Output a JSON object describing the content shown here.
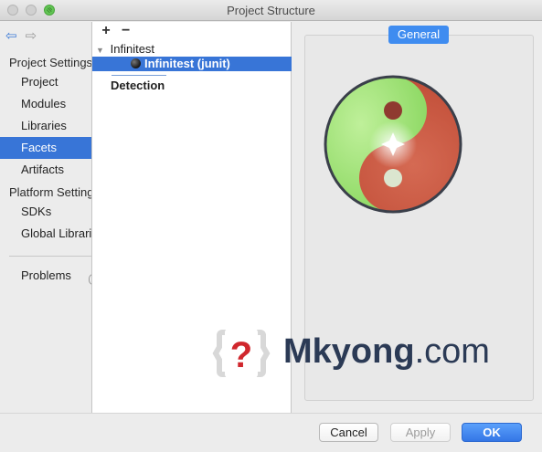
{
  "window": {
    "title": "Project Structure"
  },
  "sidebar": {
    "section_project": "Project Settings",
    "section_platform": "Platform Settings",
    "project_items": [
      "Project",
      "Modules",
      "Libraries",
      "Facets",
      "Artifacts"
    ],
    "platform_items": [
      "SDKs",
      "Global Libraries"
    ],
    "problems": "Problems",
    "selected": "Facets"
  },
  "tree": {
    "add_label": "+",
    "remove_label": "−",
    "root": "Infinitest",
    "child": "Infinitest (junit)",
    "detection": "Detection"
  },
  "detail": {
    "tab_general": "General"
  },
  "watermark": {
    "brand": "Mkyong",
    "domain": ".com"
  },
  "buttons": {
    "cancel": "Cancel",
    "apply": "Apply",
    "ok": "OK"
  },
  "colors": {
    "accent": "#3875d7",
    "logo_green": "#9fe074",
    "logo_red": "#c9563f"
  }
}
